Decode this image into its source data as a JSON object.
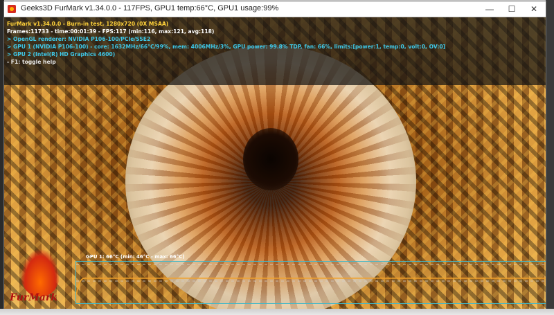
{
  "window": {
    "title": "Geeks3D FurMark v1.34.0.0 - 117FPS, GPU1 temp:66°C, GPU1 usage:99%",
    "controls": {
      "minimize": "—",
      "maximize": "☐",
      "close": "✕"
    }
  },
  "hud": {
    "line1": "FurMark v1.34.0.0 - Burn-in test, 1280x720 (0X MSAA)",
    "line2": "Frames:11733 - time:00:01:39 - FPS:117 (min:116, max:121, avg:118)",
    "line3": "> OpenGL renderer: NVIDIA P106-100/PCIe/SSE2",
    "line4": "> GPU 1 (NVIDIA P106-100) - core: 1632MHz/66°C/99%, mem: 4006MHz/3%, GPU power: 99.8% TDP, fan: 66%, limits:[power:1, temp:0, volt:0, OV:0]",
    "line5": "> GPU 2 (Intel(R) HD Graphics 4600)",
    "line6": "- F1: toggle help"
  },
  "logo": {
    "text": "FurMark"
  },
  "temp_graph": {
    "label": "GPU 1: 66°C (min: 46°C - max: 66°C)",
    "current": 66,
    "min": 46,
    "max": 66
  },
  "colors": {
    "hud_yellow": "#ffd23a",
    "hud_cyan": "#3ec8e8",
    "graph_line": "#f2a12a",
    "graph_border": "#43b8c8"
  }
}
